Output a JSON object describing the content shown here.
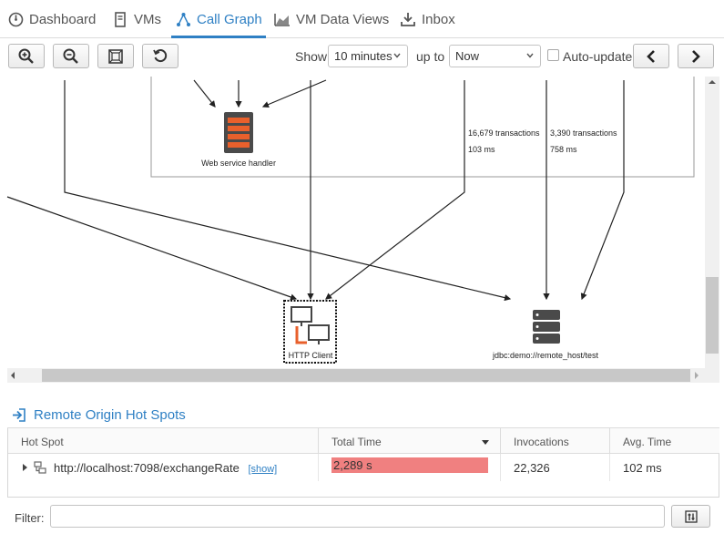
{
  "tabs": [
    {
      "label": "Dashboard",
      "icon": "dashboard-icon"
    },
    {
      "label": "VMs",
      "icon": "vm-icon"
    },
    {
      "label": "Call Graph",
      "icon": "call-graph-icon",
      "active": true
    },
    {
      "label": "VM Data Views",
      "icon": "chart-icon"
    },
    {
      "label": "Inbox",
      "icon": "download-icon"
    }
  ],
  "toolbar": {
    "show_label": "Show",
    "range_value": "10 minutes",
    "upto_label": "up to",
    "upto_value": "Now",
    "autoupdate_label": "Auto-update"
  },
  "graph": {
    "nodes": {
      "web_service": "Web service handler",
      "http_client": "HTTP Client",
      "jdbc": "jdbc:demo://remote_host/test"
    },
    "edge_labels": {
      "edge1_tx": "16,679 transactions",
      "edge1_ms": "103 ms",
      "edge2_tx": "3,390 transactions",
      "edge2_ms": "758 ms"
    }
  },
  "hotspots": {
    "title": "Remote Origin Hot Spots",
    "columns": [
      "Hot Spot",
      "Total Time",
      "Invocations",
      "Avg. Time"
    ],
    "rows": [
      {
        "hotspot": "http://localhost:7098/exchangeRate",
        "show": "[show]",
        "total_time": "2,289 s",
        "invocations": "22,326",
        "avg_time": "102 ms"
      }
    ]
  },
  "filter": {
    "label": "Filter:",
    "value": ""
  },
  "colors": {
    "accent": "#2f80c4",
    "bar": "#f08080",
    "node_orange": "#e8602c",
    "node_dark": "#4a4a4a"
  }
}
